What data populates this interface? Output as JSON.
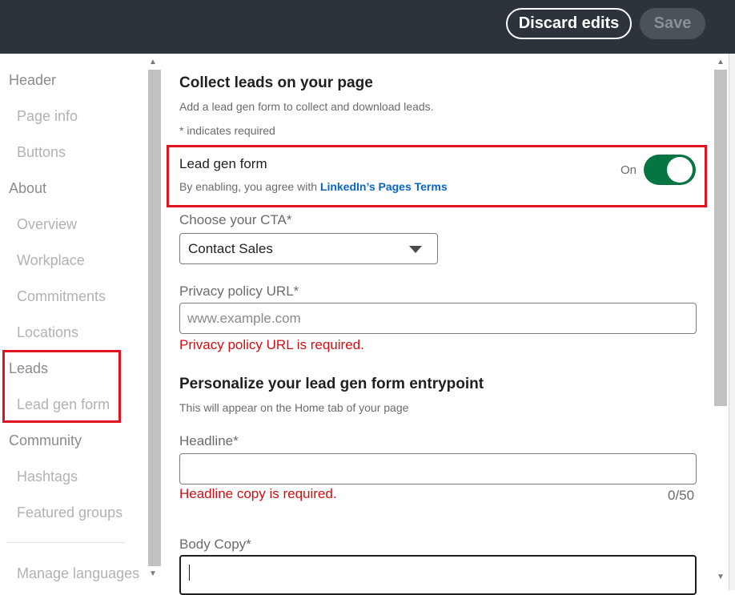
{
  "header": {
    "discard_label": "Discard edits",
    "save_label": "Save"
  },
  "sidebar": {
    "items": [
      {
        "label": "Header",
        "level": "section"
      },
      {
        "label": "Page info",
        "level": "sub"
      },
      {
        "label": "Buttons",
        "level": "sub"
      },
      {
        "label": "About",
        "level": "section"
      },
      {
        "label": "Overview",
        "level": "sub"
      },
      {
        "label": "Workplace",
        "level": "sub"
      },
      {
        "label": "Commitments",
        "level": "sub"
      },
      {
        "label": "Locations",
        "level": "sub"
      },
      {
        "label": "Leads",
        "level": "section"
      },
      {
        "label": "Lead gen form",
        "level": "sub"
      },
      {
        "label": "Community",
        "level": "section"
      },
      {
        "label": "Hashtags",
        "level": "sub"
      },
      {
        "label": "Featured groups",
        "level": "sub"
      }
    ],
    "footer_item": "Manage languages"
  },
  "main": {
    "title": "Collect leads on your page",
    "description": "Add a lead gen form to collect and download leads.",
    "required_note": "* indicates required",
    "lead_gen": {
      "label": "Lead gen form",
      "agreement_prefix": "By enabling, you agree with ",
      "agreement_link": "LinkedIn’s Pages Terms",
      "toggle_state": "On",
      "enabled": true
    },
    "cta": {
      "label": "Choose your CTA*",
      "value": "Contact Sales"
    },
    "privacy": {
      "label": "Privacy policy URL*",
      "placeholder": "www.example.com",
      "error": "Privacy policy URL is required."
    },
    "entrypoint": {
      "title": "Personalize your lead gen form entrypoint",
      "description": "This will appear on the Home tab of your page"
    },
    "headline": {
      "label": "Headline*",
      "error": "Headline copy is required.",
      "counter": "0/50"
    },
    "body_copy": {
      "label": "Body Copy*"
    }
  },
  "colors": {
    "topbar": "#2d333b",
    "toggle_on": "#057642",
    "error": "#cc1016",
    "link": "#0a66c2",
    "highlight_box": "#e0141e"
  }
}
